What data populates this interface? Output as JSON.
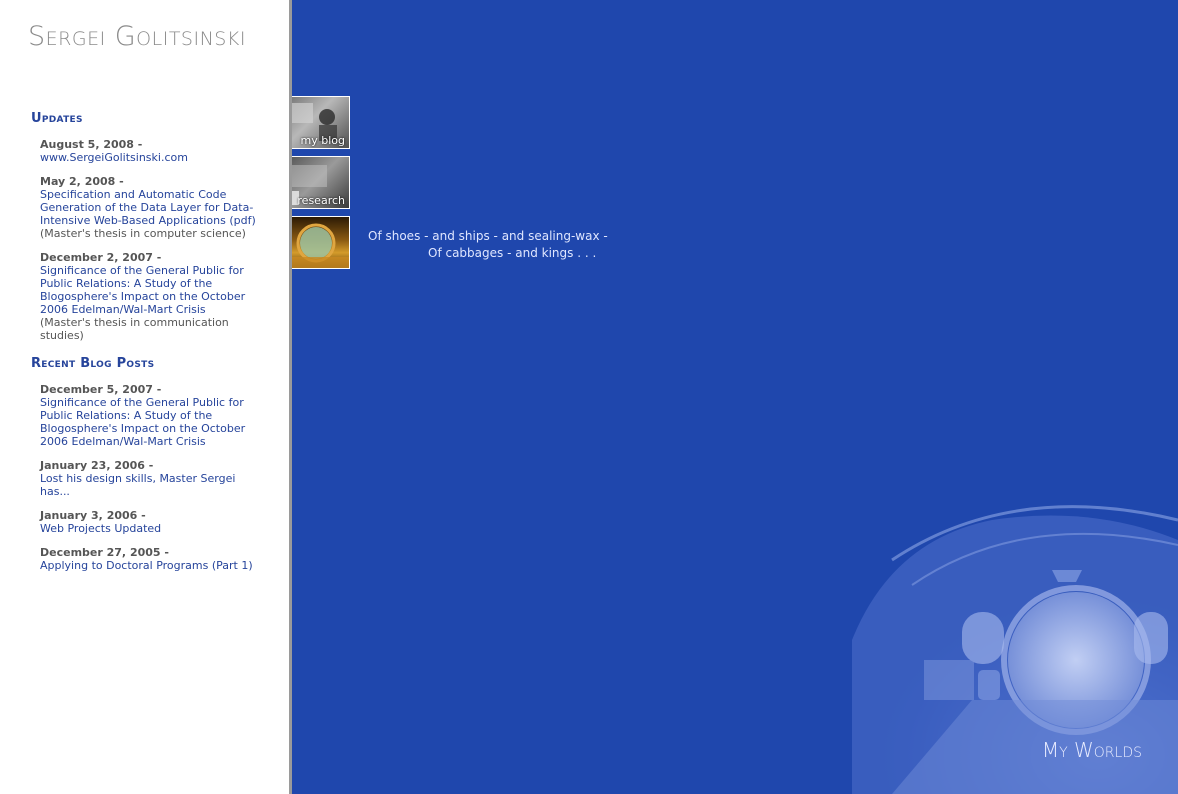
{
  "site": {
    "title": "Sergei Golitsinski"
  },
  "updates": {
    "heading": "Updates",
    "items": [
      {
        "date": "August 5, 2008 -",
        "link": "www.SergeiGolitsinski.com",
        "note": ""
      },
      {
        "date": "May 2, 2008 -",
        "link": "Specification and Automatic Code Generation of the Data Layer for Data-Intensive Web-Based Applications (pdf)",
        "note": "(Master's thesis in computer science)"
      },
      {
        "date": "December 2, 2007 -",
        "link": "Significance of the General Public for Public Relations: A Study of the Blogosphere's Impact on the October 2006 Edelman/Wal-Mart Crisis",
        "note": "(Master's thesis in communication studies)"
      }
    ]
  },
  "blog": {
    "heading": "Recent Blog Posts",
    "items": [
      {
        "date": "December 5, 2007 -",
        "link": "Significance of the General Public for Public Relations: A Study of the Blogosphere's Impact on the October 2006 Edelman/Wal-Mart Crisis"
      },
      {
        "date": "January 23, 2006 -",
        "link": "Lost his design skills, Master Sergei has..."
      },
      {
        "date": "January 3, 2006 -",
        "link": "Web Projects Updated"
      },
      {
        "date": "December 27, 2005 -",
        "link": "Applying to Doctoral Programs (Part 1)"
      }
    ]
  },
  "thumbs": {
    "blog_label": "my blog",
    "research_label": "research"
  },
  "quote": {
    "line1": "Of shoes - and ships - and sealing-wax -",
    "line2": "Of cabbages - and kings . . ."
  },
  "footer": {
    "label": "My Worlds"
  },
  "colors": {
    "main_bg": "#1f47ad",
    "link": "#26449b",
    "heading": "#26449b"
  }
}
